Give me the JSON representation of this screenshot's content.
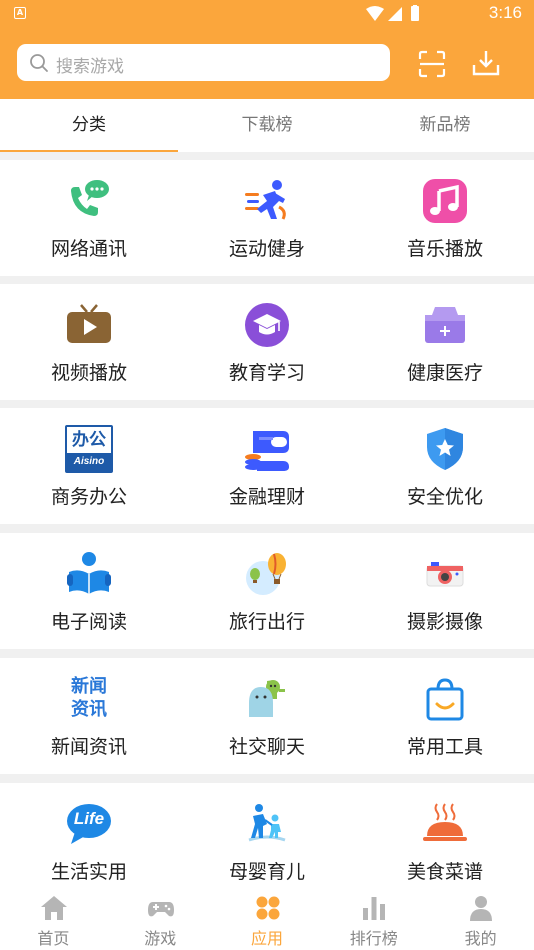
{
  "status_bar": {
    "time": "3:16"
  },
  "search": {
    "placeholder": "搜索游戏"
  },
  "tabs": [
    {
      "label": "分类",
      "active": true
    },
    {
      "label": "下载榜",
      "active": false
    },
    {
      "label": "新品榜",
      "active": false
    }
  ],
  "categories": [
    {
      "label": "网络通讯",
      "icon": "phone-chat-icon"
    },
    {
      "label": "运动健身",
      "icon": "running-icon"
    },
    {
      "label": "音乐播放",
      "icon": "music-note-icon"
    },
    {
      "label": "视频播放",
      "icon": "tv-play-icon"
    },
    {
      "label": "教育学习",
      "icon": "graduation-cap-icon"
    },
    {
      "label": "健康医疗",
      "icon": "medical-kit-icon"
    },
    {
      "label": "商务办公",
      "icon": "office-aisino-icon",
      "icon_text": [
        "办公",
        "Aisino"
      ]
    },
    {
      "label": "金融理财",
      "icon": "wallet-coins-icon"
    },
    {
      "label": "安全优化",
      "icon": "shield-star-icon"
    },
    {
      "label": "电子阅读",
      "icon": "reader-book-icon"
    },
    {
      "label": "旅行出行",
      "icon": "balloon-travel-icon"
    },
    {
      "label": "摄影摄像",
      "icon": "camera-icon"
    },
    {
      "label": "新闻资讯",
      "icon": "news-text-icon",
      "icon_text": [
        "新闻",
        "资讯"
      ]
    },
    {
      "label": "社交聊天",
      "icon": "social-figures-icon"
    },
    {
      "label": "常用工具",
      "icon": "shopping-bag-icon"
    },
    {
      "label": "生活实用",
      "icon": "life-bubble-icon",
      "icon_text": [
        "Life"
      ]
    },
    {
      "label": "母婴育儿",
      "icon": "parent-child-icon"
    },
    {
      "label": "美食菜谱",
      "icon": "food-cloche-icon"
    }
  ],
  "bottom_nav": [
    {
      "label": "首页",
      "icon": "home-icon",
      "active": false
    },
    {
      "label": "游戏",
      "icon": "gamepad-icon",
      "active": false
    },
    {
      "label": "应用",
      "icon": "apps-grid-icon",
      "active": true
    },
    {
      "label": "排行榜",
      "icon": "bar-chart-icon",
      "active": false
    },
    {
      "label": "我的",
      "icon": "user-icon",
      "active": false
    }
  ],
  "colors": {
    "accent": "#fba63c",
    "background": "#f0f0f0"
  }
}
